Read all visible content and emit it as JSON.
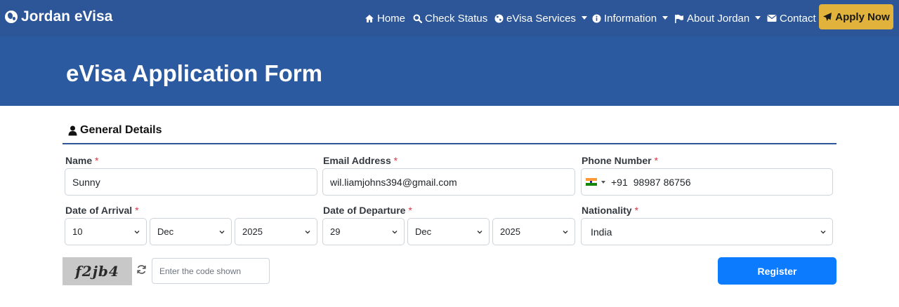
{
  "brand": {
    "name": "Jordan eVisa"
  },
  "nav": {
    "home": "Home",
    "check_status": "Check Status",
    "evisa_services": "eVisa Services",
    "information": "Information",
    "about_jordan": "About Jordan",
    "contact": "Contact",
    "apply_now": "Apply Now"
  },
  "hero": {
    "title": "eVisa Application Form"
  },
  "form": {
    "section_title": "General Details",
    "required_mark": "*",
    "name": {
      "label": "Name",
      "value": "Sunny"
    },
    "email": {
      "label": "Email Address",
      "value": "wil.liamjohns394@gmail.com"
    },
    "phone": {
      "label": "Phone Number",
      "dial_code": "+91",
      "value": "98987 86756",
      "flag_icon": "india-flag-icon"
    },
    "arrival": {
      "label": "Date of Arrival",
      "day": "10",
      "month": "Dec",
      "year": "2025"
    },
    "departure": {
      "label": "Date of Departure",
      "day": "29",
      "month": "Dec",
      "year": "2025"
    },
    "nationality": {
      "label": "Nationality",
      "value": "India"
    },
    "captcha": {
      "code": "f2jb4",
      "placeholder": "Enter the code shown"
    },
    "register_label": "Register"
  },
  "colors": {
    "navbar": "#2c5697",
    "hero": "#2c5aa0",
    "apply_button": "#e2b33c",
    "register_button": "#0d7bfd",
    "required": "#dc3545"
  }
}
